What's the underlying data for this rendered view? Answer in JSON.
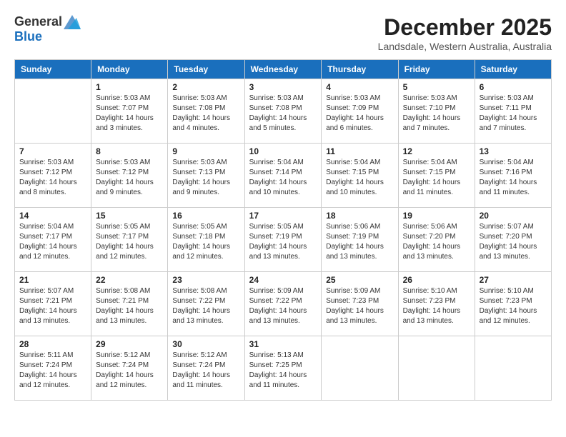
{
  "logo": {
    "general": "General",
    "blue": "Blue"
  },
  "title": "December 2025",
  "location": "Landsdale, Western Australia, Australia",
  "days_header": [
    "Sunday",
    "Monday",
    "Tuesday",
    "Wednesday",
    "Thursday",
    "Friday",
    "Saturday"
  ],
  "weeks": [
    [
      {
        "day": "",
        "info": ""
      },
      {
        "day": "1",
        "info": "Sunrise: 5:03 AM\nSunset: 7:07 PM\nDaylight: 14 hours\nand 3 minutes."
      },
      {
        "day": "2",
        "info": "Sunrise: 5:03 AM\nSunset: 7:08 PM\nDaylight: 14 hours\nand 4 minutes."
      },
      {
        "day": "3",
        "info": "Sunrise: 5:03 AM\nSunset: 7:08 PM\nDaylight: 14 hours\nand 5 minutes."
      },
      {
        "day": "4",
        "info": "Sunrise: 5:03 AM\nSunset: 7:09 PM\nDaylight: 14 hours\nand 6 minutes."
      },
      {
        "day": "5",
        "info": "Sunrise: 5:03 AM\nSunset: 7:10 PM\nDaylight: 14 hours\nand 7 minutes."
      },
      {
        "day": "6",
        "info": "Sunrise: 5:03 AM\nSunset: 7:11 PM\nDaylight: 14 hours\nand 7 minutes."
      }
    ],
    [
      {
        "day": "7",
        "info": "Sunrise: 5:03 AM\nSunset: 7:12 PM\nDaylight: 14 hours\nand 8 minutes."
      },
      {
        "day": "8",
        "info": "Sunrise: 5:03 AM\nSunset: 7:12 PM\nDaylight: 14 hours\nand 9 minutes."
      },
      {
        "day": "9",
        "info": "Sunrise: 5:03 AM\nSunset: 7:13 PM\nDaylight: 14 hours\nand 9 minutes."
      },
      {
        "day": "10",
        "info": "Sunrise: 5:04 AM\nSunset: 7:14 PM\nDaylight: 14 hours\nand 10 minutes."
      },
      {
        "day": "11",
        "info": "Sunrise: 5:04 AM\nSunset: 7:15 PM\nDaylight: 14 hours\nand 10 minutes."
      },
      {
        "day": "12",
        "info": "Sunrise: 5:04 AM\nSunset: 7:15 PM\nDaylight: 14 hours\nand 11 minutes."
      },
      {
        "day": "13",
        "info": "Sunrise: 5:04 AM\nSunset: 7:16 PM\nDaylight: 14 hours\nand 11 minutes."
      }
    ],
    [
      {
        "day": "14",
        "info": "Sunrise: 5:04 AM\nSunset: 7:17 PM\nDaylight: 14 hours\nand 12 minutes."
      },
      {
        "day": "15",
        "info": "Sunrise: 5:05 AM\nSunset: 7:17 PM\nDaylight: 14 hours\nand 12 minutes."
      },
      {
        "day": "16",
        "info": "Sunrise: 5:05 AM\nSunset: 7:18 PM\nDaylight: 14 hours\nand 12 minutes."
      },
      {
        "day": "17",
        "info": "Sunrise: 5:05 AM\nSunset: 7:19 PM\nDaylight: 14 hours\nand 13 minutes."
      },
      {
        "day": "18",
        "info": "Sunrise: 5:06 AM\nSunset: 7:19 PM\nDaylight: 14 hours\nand 13 minutes."
      },
      {
        "day": "19",
        "info": "Sunrise: 5:06 AM\nSunset: 7:20 PM\nDaylight: 14 hours\nand 13 minutes."
      },
      {
        "day": "20",
        "info": "Sunrise: 5:07 AM\nSunset: 7:20 PM\nDaylight: 14 hours\nand 13 minutes."
      }
    ],
    [
      {
        "day": "21",
        "info": "Sunrise: 5:07 AM\nSunset: 7:21 PM\nDaylight: 14 hours\nand 13 minutes."
      },
      {
        "day": "22",
        "info": "Sunrise: 5:08 AM\nSunset: 7:21 PM\nDaylight: 14 hours\nand 13 minutes."
      },
      {
        "day": "23",
        "info": "Sunrise: 5:08 AM\nSunset: 7:22 PM\nDaylight: 14 hours\nand 13 minutes."
      },
      {
        "day": "24",
        "info": "Sunrise: 5:09 AM\nSunset: 7:22 PM\nDaylight: 14 hours\nand 13 minutes."
      },
      {
        "day": "25",
        "info": "Sunrise: 5:09 AM\nSunset: 7:23 PM\nDaylight: 14 hours\nand 13 minutes."
      },
      {
        "day": "26",
        "info": "Sunrise: 5:10 AM\nSunset: 7:23 PM\nDaylight: 14 hours\nand 13 minutes."
      },
      {
        "day": "27",
        "info": "Sunrise: 5:10 AM\nSunset: 7:23 PM\nDaylight: 14 hours\nand 12 minutes."
      }
    ],
    [
      {
        "day": "28",
        "info": "Sunrise: 5:11 AM\nSunset: 7:24 PM\nDaylight: 14 hours\nand 12 minutes."
      },
      {
        "day": "29",
        "info": "Sunrise: 5:12 AM\nSunset: 7:24 PM\nDaylight: 14 hours\nand 12 minutes."
      },
      {
        "day": "30",
        "info": "Sunrise: 5:12 AM\nSunset: 7:24 PM\nDaylight: 14 hours\nand 11 minutes."
      },
      {
        "day": "31",
        "info": "Sunrise: 5:13 AM\nSunset: 7:25 PM\nDaylight: 14 hours\nand 11 minutes."
      },
      {
        "day": "",
        "info": ""
      },
      {
        "day": "",
        "info": ""
      },
      {
        "day": "",
        "info": ""
      }
    ]
  ]
}
